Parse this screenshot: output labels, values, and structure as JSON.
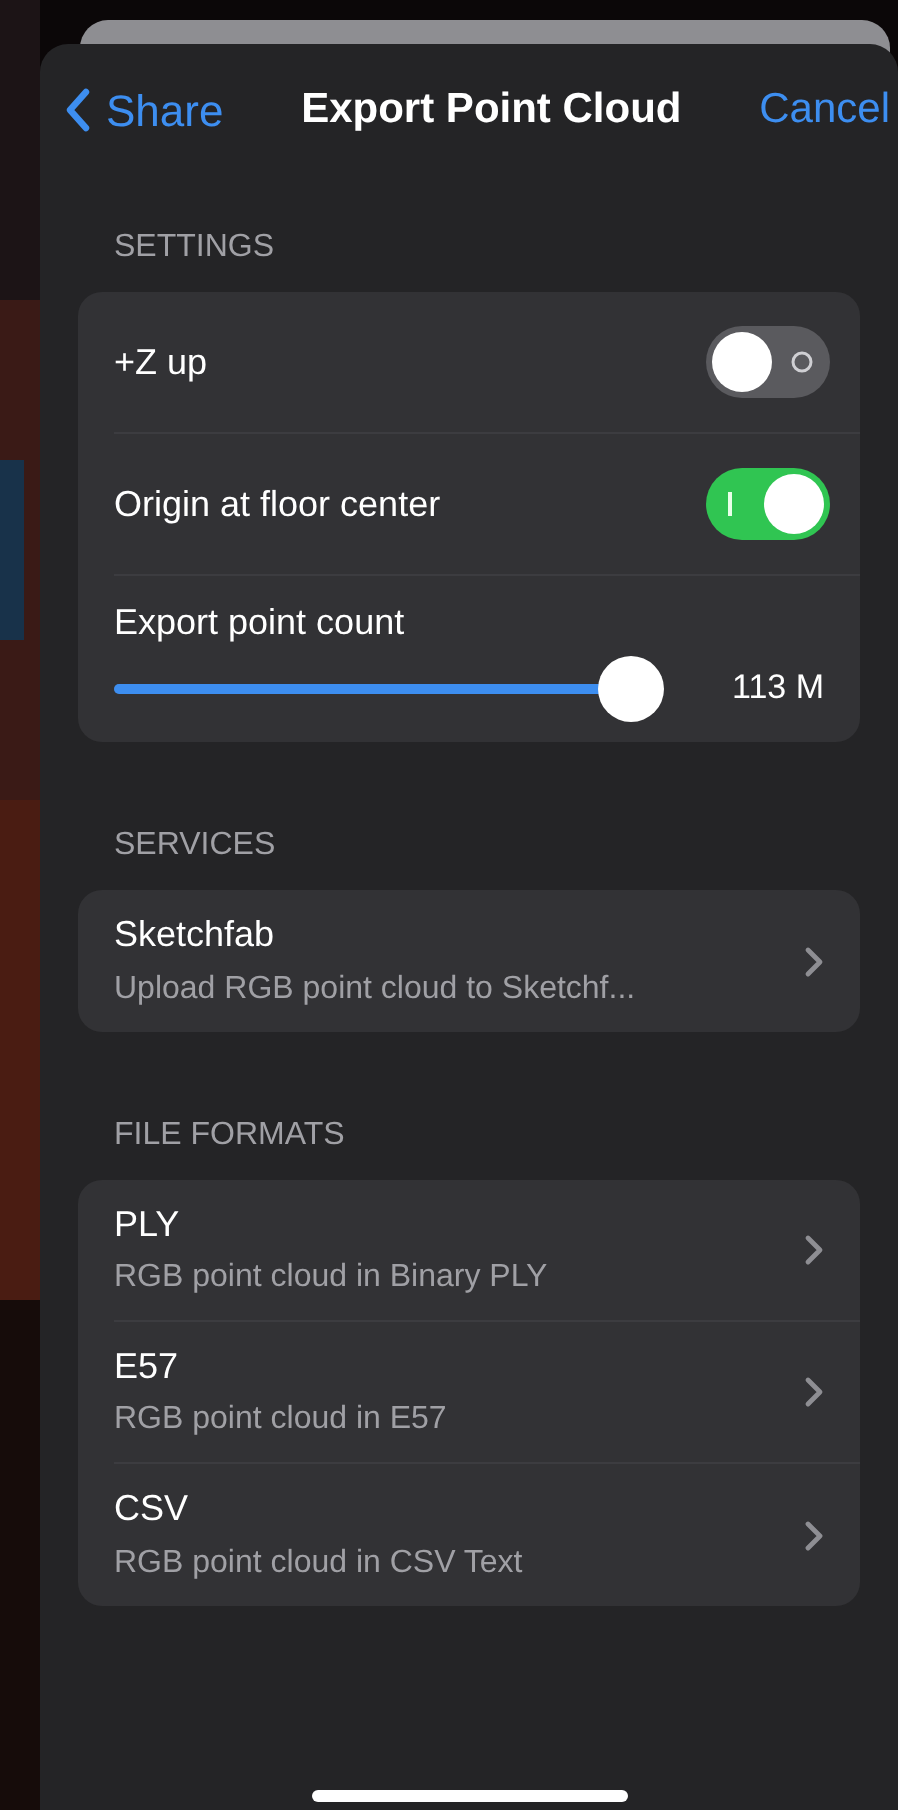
{
  "nav": {
    "back": "Share",
    "title": "Export Point Cloud",
    "cancel": "Cancel"
  },
  "sections": [
    {
      "header": "SETTINGS",
      "rows": [
        {
          "kind": "toggle",
          "label": "+Z up",
          "on": false
        },
        {
          "kind": "toggle",
          "label": "Origin at floor center",
          "on": true
        },
        {
          "kind": "slider",
          "label": "Export point count",
          "level": 0.95,
          "reading": "113 M"
        }
      ]
    },
    {
      "header": "SERVICES",
      "rows": [
        {
          "kind": "link",
          "label": "Sketchfab",
          "subtitle": "Upload RGB point cloud to Sketchf..."
        }
      ]
    },
    {
      "header": "FILE FORMATS",
      "rows": [
        {
          "kind": "link",
          "label": "PLY",
          "subtitle": "RGB point cloud in Binary PLY"
        },
        {
          "kind": "link",
          "label": "E57",
          "subtitle": "RGB point cloud in E57"
        },
        {
          "kind": "link",
          "label": "CSV",
          "subtitle": "RGB point cloud in CSV Text"
        }
      ]
    }
  ]
}
